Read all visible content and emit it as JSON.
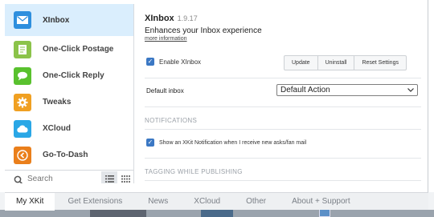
{
  "sidebar": {
    "items": [
      {
        "label": "XInbox",
        "icon": "envelope-icon",
        "color": "#2e8fde",
        "active": true
      },
      {
        "label": "One-Click Postage",
        "icon": "document-icon",
        "color": "#8bc34a"
      },
      {
        "label": "One-Click Reply",
        "icon": "speech-bubble-icon",
        "color": "#59c12e"
      },
      {
        "label": "Tweaks",
        "icon": "gear-icon",
        "color": "#f0a022"
      },
      {
        "label": "XCloud",
        "icon": "cloud-icon",
        "color": "#2aa7e6"
      },
      {
        "label": "Go-To-Dash",
        "icon": "arrow-left-icon",
        "color": "#ea7f1b"
      }
    ],
    "search_placeholder": "Search",
    "list_view_icon": "list-view-icon",
    "grid_view_icon": "grid-view-icon"
  },
  "panel": {
    "title": "XInbox",
    "version": "1.9.17",
    "description": "Enhances your Inbox experience",
    "more_info": "more information",
    "enable_label": "Enable XInbox",
    "enabled": true,
    "buttons": [
      "Update",
      "Uninstall",
      "Reset Settings"
    ],
    "default_inbox_label": "Default inbox",
    "default_inbox_value": "Default Action",
    "sections": [
      {
        "heading": "NOTIFICATIONS",
        "options": [
          {
            "label": "Show an XKit Notification when I receive new asks/fan mail",
            "checked": true
          }
        ]
      },
      {
        "heading": "TAGGING WHILE PUBLISHING"
      }
    ]
  },
  "tabs": [
    "My XKit",
    "Get Extensions",
    "News",
    "XCloud",
    "Other",
    "About + Support"
  ],
  "active_tab": "My XKit",
  "colors": {
    "accent": "#3b78c4",
    "active_row": "#daeefd"
  }
}
